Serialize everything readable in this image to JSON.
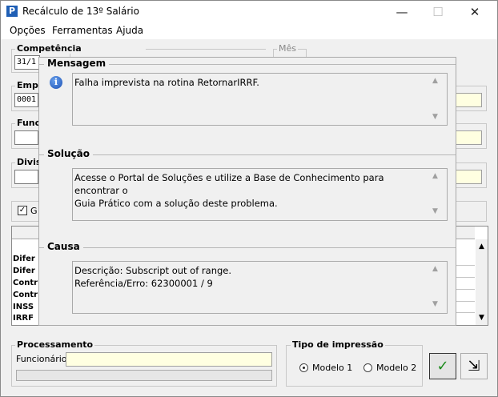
{
  "window": {
    "title": "Recálculo de 13º Salário",
    "app_icon_letter": "P",
    "minimize_symbol": "—",
    "maximize_symbol": "☐",
    "close_symbol": "✕"
  },
  "menu": [
    "Opções",
    "Ferramentas",
    "Ajuda"
  ],
  "form": {
    "competencia_label": "Competência",
    "competencia_value": "31/1",
    "mes_label": "Mês",
    "empresa_label": "Emp",
    "empresa_value": "0001",
    "funcionario_label": "Func",
    "divisao_label": "Divis",
    "check_label": "G",
    "check_mark": "✓"
  },
  "table_rows": [
    "Difer",
    "Difer",
    "Contr",
    "Contr",
    "INSS",
    "IRRF"
  ],
  "dialog": {
    "mensagem_title": "Mensagem",
    "mensagem_text": "Falha imprevista na rotina RetornarIRRF.",
    "solucao_title": "Solução",
    "solucao_text": "Acesse o Portal de Soluções e utilize a Base de Conhecimento para encontrar o\nGuia Prático com a solução deste problema.",
    "causa_title": "Causa",
    "causa_text": "Descrição: Subscript out of range.\nReferência/Erro: 62300001 / 9"
  },
  "processamento": {
    "title": "Processamento",
    "funcionario_label": "Funcionário:"
  },
  "tipo_impressao": {
    "title": "Tipo de impressão",
    "options": [
      "Modelo 1",
      "Modelo 2"
    ],
    "selected": "Modelo 1"
  },
  "buttons": {
    "ok_symbol": "✓",
    "exit_symbol": "⇲"
  },
  "icons": {
    "info": "info-icon",
    "scroll_up": "▲",
    "scroll_down": "▼",
    "accent_green": "#1a8a1a"
  }
}
